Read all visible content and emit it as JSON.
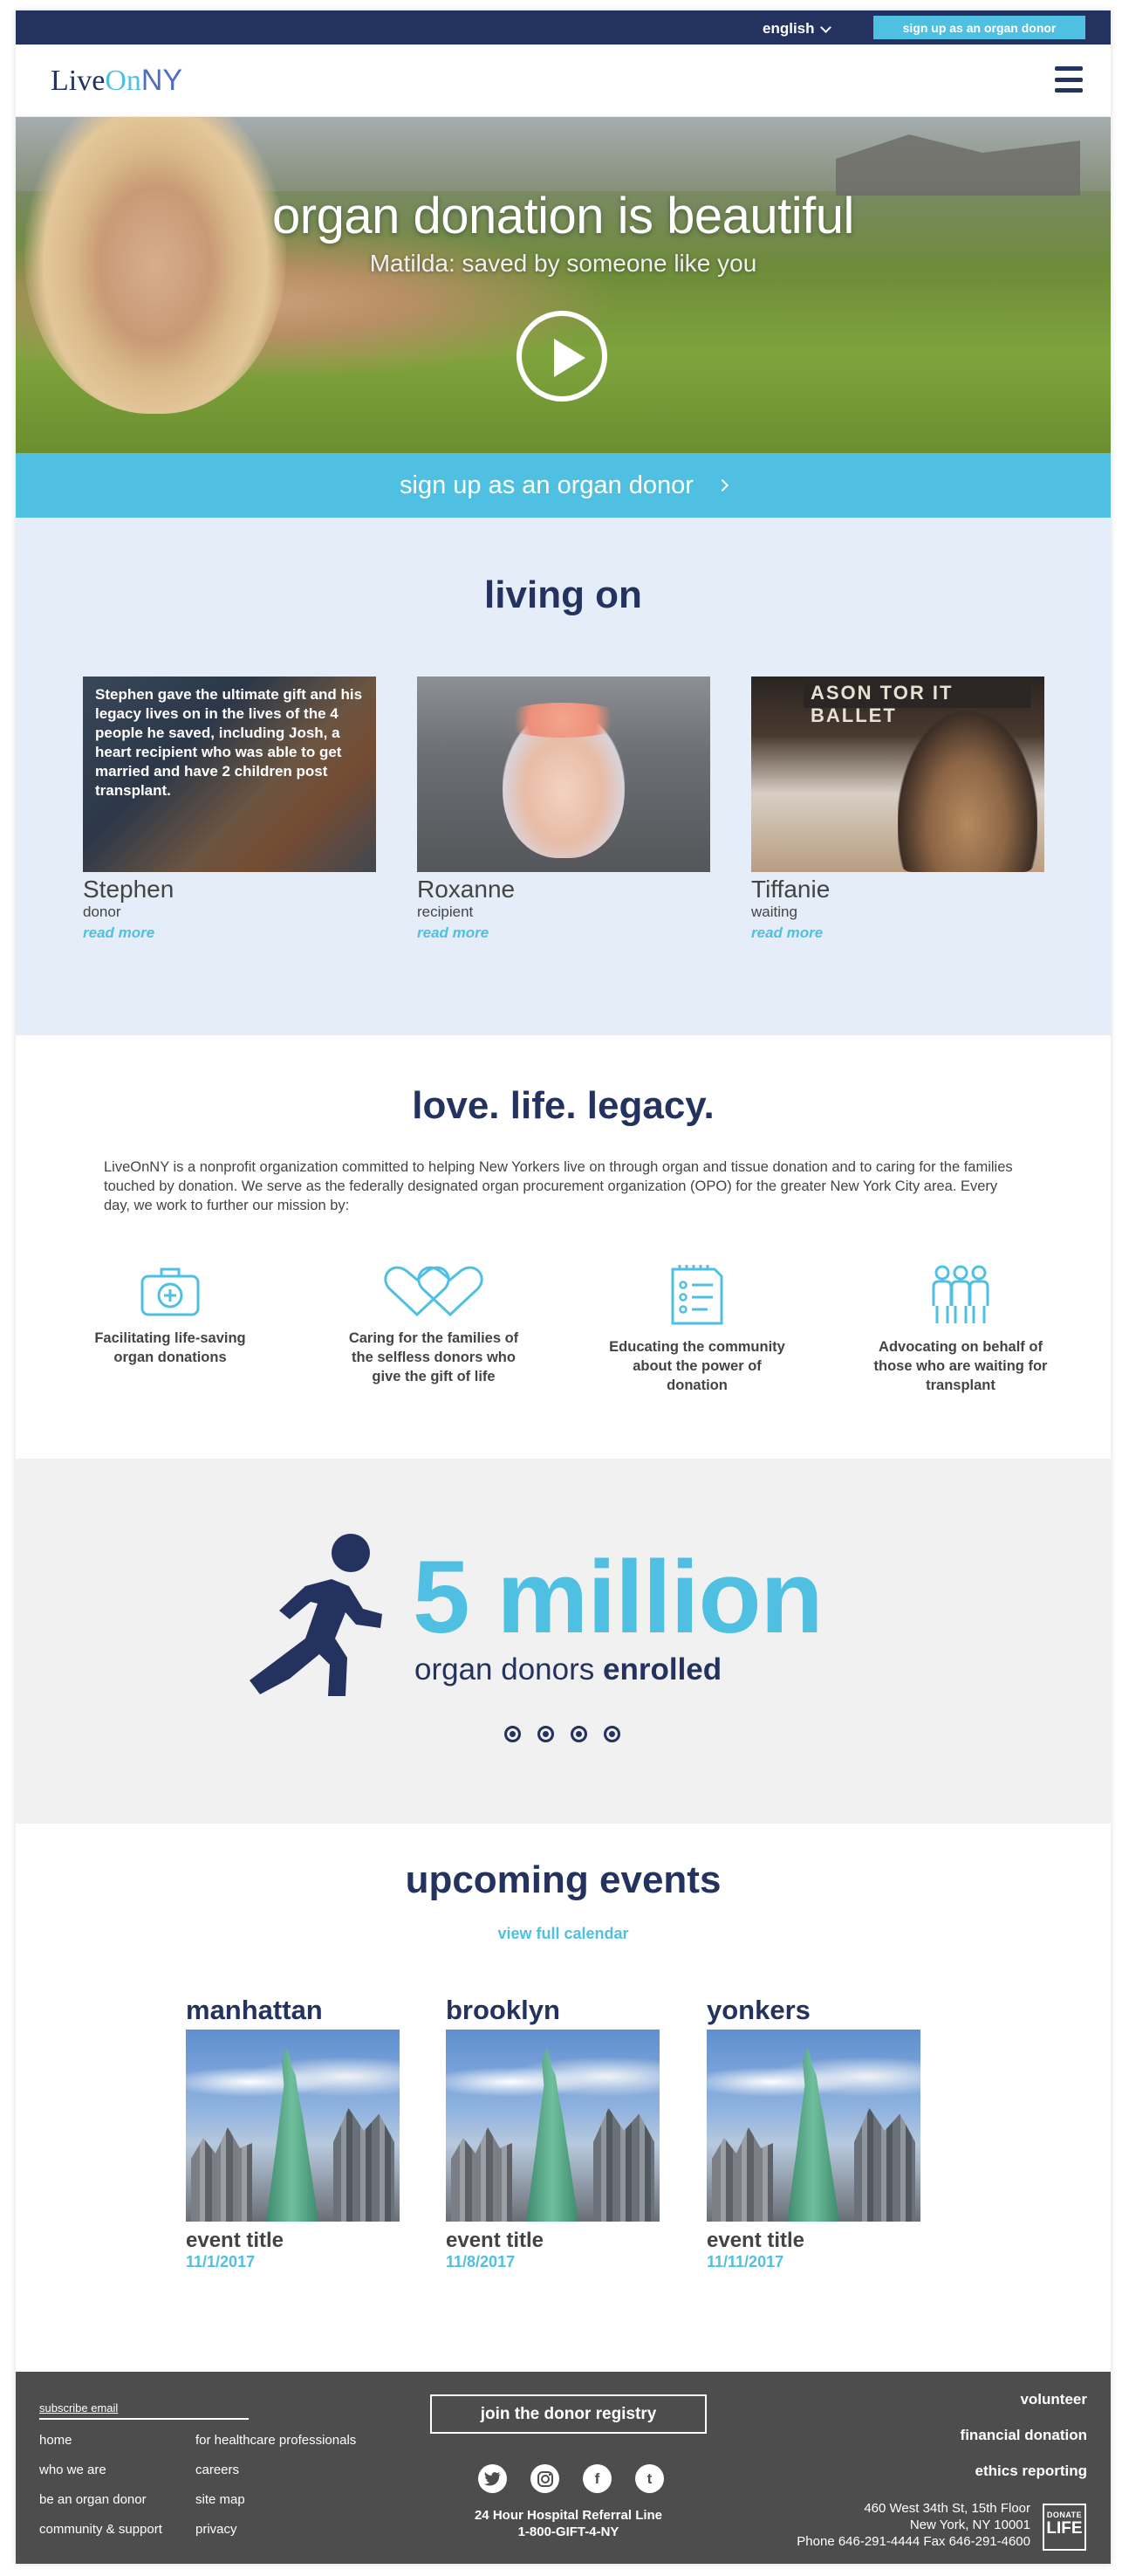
{
  "topbar": {
    "language": "english",
    "signup_button": "sign up as an organ donor"
  },
  "header": {
    "logo_live": "Live",
    "logo_on": "On",
    "logo_ny": "NY"
  },
  "hero": {
    "title": "organ donation is beautiful",
    "subtitle": "Matilda: saved by someone like you"
  },
  "signup_band": {
    "label": "sign up as an organ donor"
  },
  "living_on": {
    "title": "living on",
    "stories": [
      {
        "name": "Stephen",
        "role": "donor",
        "link": "read more",
        "quote": "Stephen gave the ultimate gift and his legacy lives on in the lives of  the 4 people he saved, including Josh, a heart recipient who was able to get married and have 2 children post transplant."
      },
      {
        "name": "Roxanne",
        "role": "recipient",
        "link": "read more"
      },
      {
        "name": "Tiffanie",
        "role": "waiting",
        "link": "read more",
        "photo_sign": "ASON  TOR IT BALLET"
      }
    ]
  },
  "love": {
    "title": "love. life. legacy.",
    "mission": "LiveOnNY is a nonprofit organization committed to helping New Yorkers live on through organ and tissue donation and to caring for the families touched by donation. We serve as the federally designated organ procurement organization (OPO) for the greater New York City area. Every day, we work to further our mission by:",
    "pillars": [
      {
        "icon": "medical-kit-icon",
        "label": "Facilitating life-saving organ donations"
      },
      {
        "icon": "hearts-icon",
        "label": "Caring for the families of the selfless donors who give the gift of life"
      },
      {
        "icon": "checklist-icon",
        "label": "Educating the community about the power of donation"
      },
      {
        "icon": "people-icon",
        "label": "Advocating on behalf of those who are waiting for transplant"
      }
    ],
    "accent_color": "#4fc0e1"
  },
  "stats": {
    "number": "5 million",
    "caption_prefix": "organ donors",
    "caption_bold": "enrolled",
    "slides": 4
  },
  "events": {
    "title": "upcoming events",
    "calendar_link": "view full calendar",
    "items": [
      {
        "city": "manhattan",
        "title": "event title",
        "date": "11/1/2017"
      },
      {
        "city": "brooklyn",
        "title": "event title",
        "date": "11/8/2017"
      },
      {
        "city": "yonkers",
        "title": "event title",
        "date": "11/11/2017"
      }
    ]
  },
  "footer": {
    "subscribe": "subscribe email",
    "links_left": [
      "home",
      "who we are",
      "be an organ donor",
      "community & support"
    ],
    "links_mid": [
      "for healthcare professionals",
      "careers",
      "site map",
      "privacy"
    ],
    "registry_button": "join the donor registry",
    "social": [
      "twitter-icon",
      "instagram-icon",
      "facebook-icon",
      "tumblr-icon"
    ],
    "referral_line1": "24 Hour Hospital Referral Line",
    "referral_line2": "1-800-GIFT-4-NY",
    "links_right": [
      "volunteer",
      "financial donation",
      "ethics reporting"
    ],
    "address_line1": "460 West 34th St, 15th Floor",
    "address_line2": "New York, NY 10001",
    "address_line3": "Phone 646-291-4444     Fax 646-291-4600",
    "badge_top": "DONATE",
    "badge_bottom": "LIFE"
  },
  "colors": {
    "navy": "#23325f",
    "accent": "#4fc0e1",
    "living_bg": "#e5edf9",
    "stats_bg": "#f1f1f1",
    "footer_bg": "#4d4d4d"
  }
}
